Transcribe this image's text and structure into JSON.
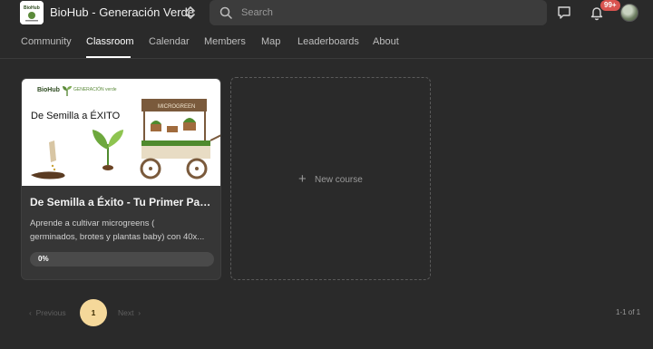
{
  "header": {
    "logo_alt": "BioHub",
    "brand": "BioHub - Generación Verde",
    "search_placeholder": "Search",
    "notification_count": "99+"
  },
  "tabs": [
    {
      "label": "Community"
    },
    {
      "label": "Classroom"
    },
    {
      "label": "Calendar"
    },
    {
      "label": "Members"
    },
    {
      "label": "Map"
    },
    {
      "label": "Leaderboards"
    },
    {
      "label": "About"
    }
  ],
  "course": {
    "thumb_brand": "BioHub",
    "thumb_sub": "GENERACIÓN verde",
    "thumb_title": "De Semilla a ÉXITO",
    "thumb_stall": "MICROGREEN",
    "title": "De Semilla a Éxito - Tu Primer Paso...",
    "description_line1": "Aprende a cultivar microgreens (",
    "description_line2": "germinados, brotes y plantas baby) con 40x...",
    "progress_label": "0%",
    "progress_value": 0
  },
  "new_course": {
    "label": "New course"
  },
  "pagination": {
    "prev": "Previous",
    "page": "1",
    "next": "Next",
    "range": "1-1 of 1"
  },
  "colors": {
    "background": "#2a2a2a",
    "accent_page": "#f5d89a",
    "badge": "#d9534f"
  }
}
